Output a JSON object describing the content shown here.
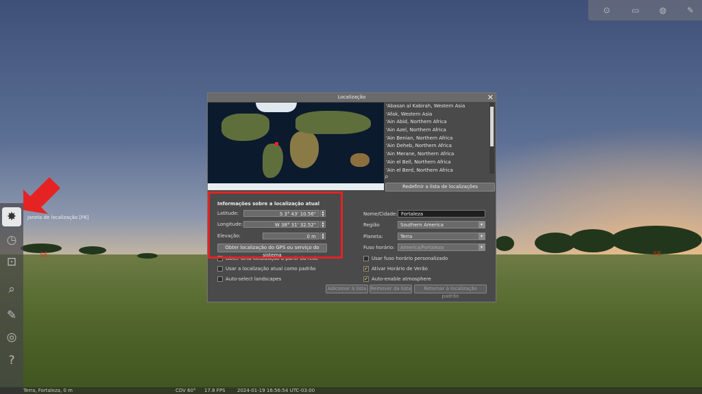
{
  "window": {
    "title": "Localização",
    "close": "✕"
  },
  "topbar": {
    "icons": [
      "mouse-icon",
      "monitor-icon",
      "globe-icon",
      "wrench-icon"
    ]
  },
  "sidebar": {
    "items": [
      {
        "name": "location-window-icon",
        "glyph": "✸"
      },
      {
        "name": "date-time-icon",
        "glyph": "◷"
      },
      {
        "name": "sky-viewing-icon",
        "glyph": "⊡"
      },
      {
        "name": "search-icon",
        "glyph": "⌕"
      },
      {
        "name": "configuration-icon",
        "glyph": "⚙"
      },
      {
        "name": "astronomical-calculations-icon",
        "glyph": "◎"
      },
      {
        "name": "help-icon",
        "glyph": "?"
      }
    ],
    "tooltip": "Janela de localização  [F6]"
  },
  "compass": {
    "left": "SE",
    "right": "SE"
  },
  "locations": [
    "'Abasan al Kabirah, Western Asia",
    "'Afak, Western Asia",
    "'Ain Abid, Northern Africa",
    "'Ain Azel, Northern Africa",
    "'Ain Benian, Northern Africa",
    "'Ain Deheb, Northern Africa",
    "'Ain Merane, Northern Africa",
    "'Ain el Bell, Northern Africa",
    "'Ain el Berd, Northern Africa"
  ],
  "reset_list_button": "Redefinir a lista de localizações",
  "current_info": {
    "title": "Informações sobre a localização atual",
    "latitude_label": "Latitude:",
    "latitude_value": "S 3° 43' 10.56\"",
    "longitude_label": "Longitude:",
    "longitude_value": "W 38° 31' 32.52\"",
    "elevation_label": "Elevação:",
    "elevation_value": "0 m",
    "gps_button": "Obter localização do GPS ou serviço do sistema"
  },
  "right_form": {
    "name_label": "Nome/Cidade:",
    "name_value": "Fortaleza",
    "region_label": "Região",
    "region_value": "Southern America",
    "planet_label": "Planeta:",
    "planet_value": "Terra",
    "tz_label": "Fuso horário:",
    "tz_value": "America/Fortaleza"
  },
  "checkboxes_left": [
    {
      "label": "Obter uma localização a partir da rede",
      "checked": false
    },
    {
      "label": "Usar a localização atual como padrão",
      "checked": false
    },
    {
      "label": "Auto-select landscapes",
      "checked": false
    }
  ],
  "checkboxes_right": [
    {
      "label": "Usar fuso horário personalizado",
      "checked": false
    },
    {
      "label": "Ativar Horário de Verão",
      "checked": true
    },
    {
      "label": "Auto-enable atmosphere",
      "checked": true
    }
  ],
  "bottom_buttons": {
    "add": "Adicionar à lista",
    "remove": "Remover da lista",
    "return": "Retornar à localização padrão"
  },
  "statusbar": {
    "location": "Terra, Fortaleza, 0 m",
    "fov": "CDV 60°",
    "fps": "17.8 FPS",
    "datetime": "2024-01-19 16:56:54 UTC-03:00"
  },
  "colors": {
    "highlight_box": "#e52323",
    "arrow": "#e52323"
  }
}
